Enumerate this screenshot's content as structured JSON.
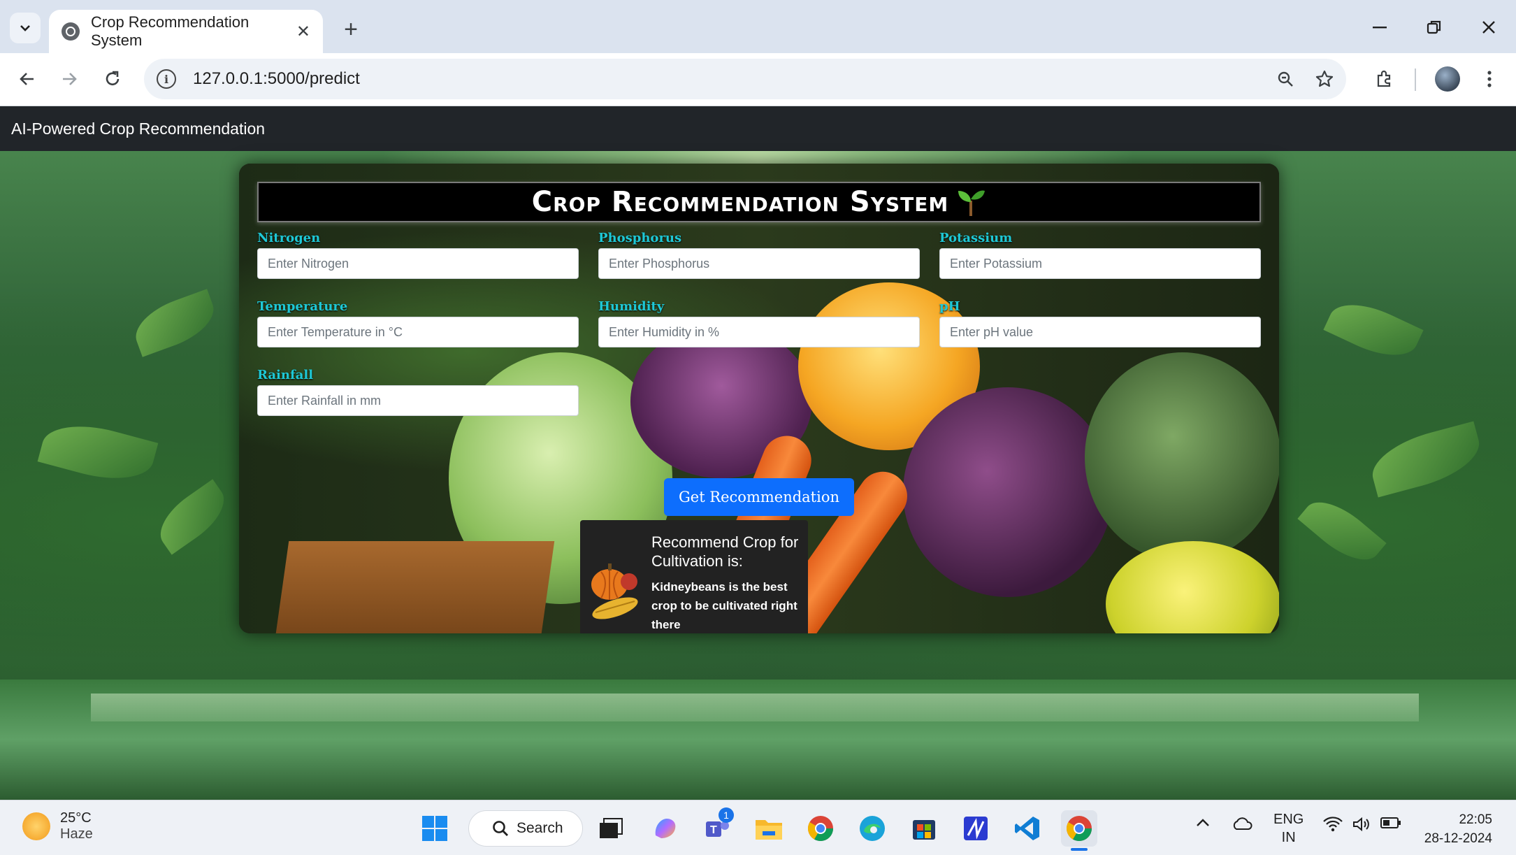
{
  "browser": {
    "tab_title": "Crop Recommendation System",
    "url": "127.0.0.1:5000/predict"
  },
  "navbar": {
    "brand": "AI-Powered Crop Recommendation"
  },
  "form": {
    "heading": "Crop Recommendation System",
    "fields": [
      {
        "label": "Nitrogen",
        "placeholder": "Enter Nitrogen"
      },
      {
        "label": "Phosphorus",
        "placeholder": "Enter Phosphorus"
      },
      {
        "label": "Potassium",
        "placeholder": "Enter Potassium"
      },
      {
        "label": "Temperature",
        "placeholder": "Enter Temperature in °C"
      },
      {
        "label": "Humidity",
        "placeholder": "Enter Humidity in %"
      },
      {
        "label": "pH",
        "placeholder": "Enter pH value"
      },
      {
        "label": "Rainfall",
        "placeholder": "Enter Rainfall in mm"
      }
    ],
    "submit_label": "Get Recommendation"
  },
  "result": {
    "heading": "Recommend Crop for Cultivation is:",
    "text": "Kidneybeans is the best crop to be cultivated right there"
  },
  "taskbar": {
    "weather_temp": "25°C",
    "weather_desc": "Haze",
    "search_label": "Search",
    "teams_badge": "1",
    "lang_top": "ENG",
    "lang_bottom": "IN",
    "time": "22:05",
    "date": "28-12-2024"
  },
  "colors": {
    "navbar": "#212529",
    "label": "#1ec8d6",
    "button": "#0d6efd",
    "result_bg": "#222222"
  }
}
